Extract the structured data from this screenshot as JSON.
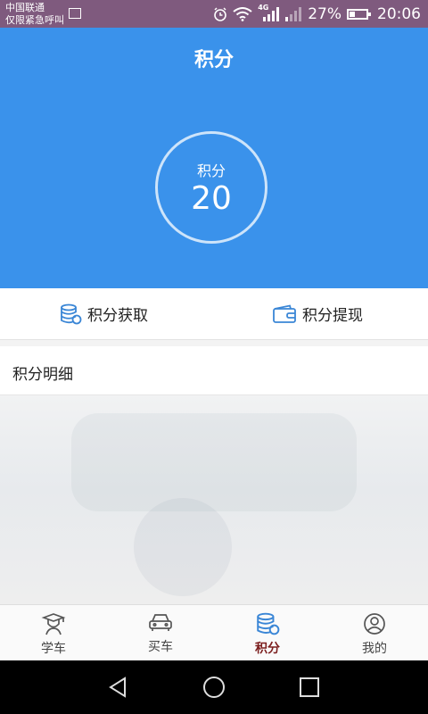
{
  "status_bar": {
    "carrier_line1": "中国联通",
    "carrier_line2": "仅限紧急呼叫",
    "network_type": "4G",
    "battery_percent": "27%",
    "time": "20:06"
  },
  "header": {
    "title": "积分",
    "points_label": "积分",
    "points_value": "20"
  },
  "actions": {
    "earn_label": "积分获取",
    "withdraw_label": "积分提现"
  },
  "detail": {
    "title": "积分明细"
  },
  "tabs": [
    {
      "label": "学车",
      "icon": "student-icon"
    },
    {
      "label": "买车",
      "icon": "car-icon"
    },
    {
      "label": "积分",
      "icon": "coins-icon",
      "active": true
    },
    {
      "label": "我的",
      "icon": "profile-icon"
    }
  ],
  "colors": {
    "header_bg": "#3a92eb",
    "accent_icon": "#3a86d6",
    "active_tab": "#7c1f1f",
    "status_bar": "#7f5a7e"
  }
}
